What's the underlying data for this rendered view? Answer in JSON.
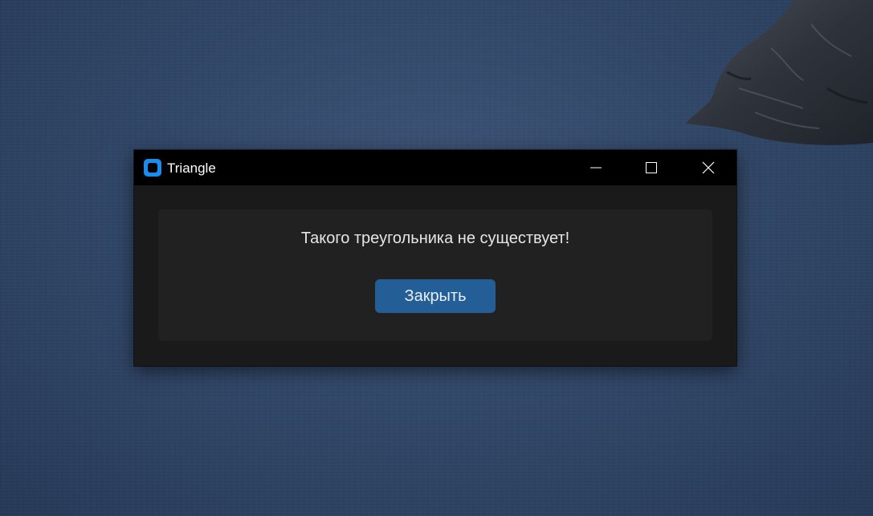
{
  "desktop": {
    "wallpaper": "sea-and-cliff-wallpaper"
  },
  "window": {
    "title": "Triangle",
    "app_icon": "app-icon",
    "controls": {
      "minimize_icon": "minimize-icon",
      "maximize_icon": "maximize-icon",
      "close_icon": "close-icon"
    }
  },
  "dialog": {
    "message": "Такого треугольника не существует!",
    "close_button_label": "Закрыть"
  },
  "colors": {
    "titlebar": "#000000",
    "window_bg": "#1a1a1a",
    "frame_bg": "#212121",
    "button_bg": "#245e97",
    "app_icon_accent": "#1a8cf0"
  }
}
